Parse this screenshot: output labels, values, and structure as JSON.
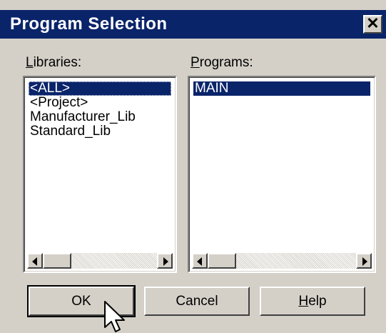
{
  "window": {
    "title": "Program Selection",
    "close_label": "✕"
  },
  "libraries": {
    "label_mnemonic": "L",
    "label_rest": "ibraries:",
    "items": [
      "<ALL>",
      "<Project>",
      "Manufacturer_Lib",
      "Standard_Lib"
    ],
    "selected": "<ALL>"
  },
  "programs": {
    "label_mnemonic": "P",
    "label_rest": "rograms:",
    "items": [
      "MAIN"
    ],
    "selected": "MAIN"
  },
  "buttons": {
    "ok": "OK",
    "cancel": "Cancel",
    "help_mnemonic": "H",
    "help_rest": "elp"
  },
  "colors": {
    "titlebar": "#0a246a",
    "selection": "#0a246a",
    "face": "#d4d0c8"
  }
}
